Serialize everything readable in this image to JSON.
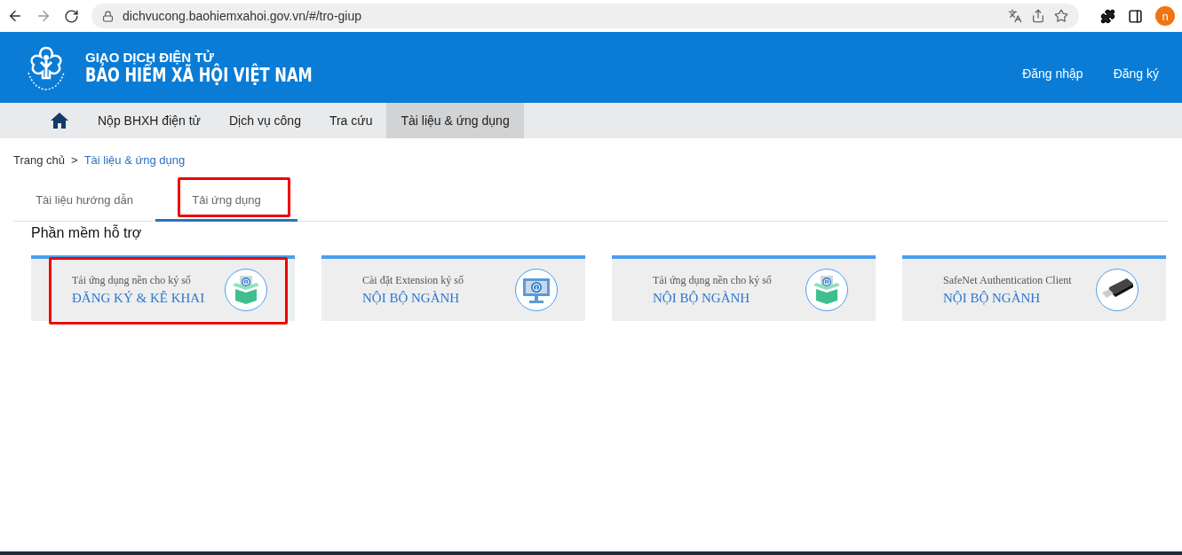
{
  "browser": {
    "url": "dichvucong.baohiemxahoi.gov.vn/#/tro-giup",
    "profile": "n"
  },
  "header": {
    "subtitle": "GIAO DỊCH ĐIỆN TỬ",
    "title": "BẢO HIỂM XÃ HỘI VIỆT NAM",
    "links": [
      "Đăng nhập",
      "Đăng ký"
    ]
  },
  "nav": [
    {
      "label": "Nộp BHXH điện tử",
      "selected": false
    },
    {
      "label": "Dịch vụ công",
      "selected": false
    },
    {
      "label": "Tra cứu",
      "selected": false
    },
    {
      "label": "Tài liệu & ứng dụng",
      "selected": true
    }
  ],
  "breadcrumb": [
    "Trang chủ",
    ">",
    "Tài liệu & ứng dụng"
  ],
  "tabs": [
    {
      "label": "Tài liệu hướng dẫn",
      "selected": false,
      "highlighted": false
    },
    {
      "label": "Tải ứng dụng",
      "selected": true,
      "highlighted": true
    }
  ],
  "section_title": "Phần mềm hỗ trợ",
  "cards": [
    {
      "caption": "Tải ứng dụng nền cho ký số",
      "title": "ĐĂNG KÝ & KÊ KHAI",
      "kind": "box",
      "highlighted": true
    },
    {
      "caption": "Cài đặt Extension ký số",
      "title": "NỘI BỘ NGÀNH",
      "kind": "monitor",
      "highlighted": false
    },
    {
      "caption": "Tải ứng dụng nền cho ký số",
      "title": "NỘI BỘ NGÀNH",
      "kind": "box",
      "highlighted": false
    },
    {
      "caption": "SafeNet Authentication Client",
      "title": "NỘI BỘ NGÀNH",
      "kind": "usb",
      "highlighted": false
    }
  ]
}
